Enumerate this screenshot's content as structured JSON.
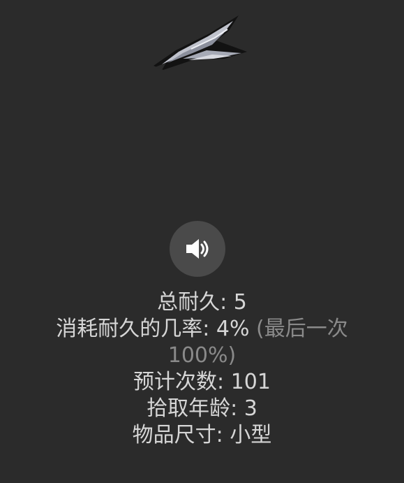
{
  "item": {
    "image_name": "feather-blade-icon"
  },
  "audio": {
    "icon": "speaker-icon"
  },
  "stats": {
    "total_durability": "总耐久: 5",
    "consume_chance": "消耗耐久的几率: 4%",
    "consume_chance_last": "(最后一次 100%)",
    "estimated_uses": "预计次数: 101",
    "pickup_age": "拾取年龄: 3",
    "item_size": "物品尺寸: 小型"
  },
  "colors": {
    "background": "#2b2b2b",
    "text": "#d6d6d6",
    "muted_text": "#8a8a8a",
    "button_bg": "#4a4a4a"
  }
}
